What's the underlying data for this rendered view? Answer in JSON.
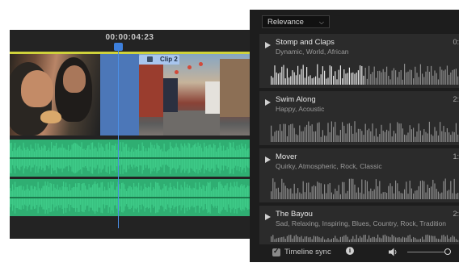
{
  "timeline": {
    "timecode": "00:00:04:23",
    "clip_label": "Clip 2",
    "accent_color": "#4c77b8",
    "audio_color": "#3ecb88"
  },
  "music_panel": {
    "sort_value": "Relevance",
    "tracks": [
      {
        "title": "Stomp and Claps",
        "tags": "Dynamic, World, African",
        "duration": "0:"
      },
      {
        "title": "Swim Along",
        "tags": "Happy, Acoustic",
        "duration": "2:"
      },
      {
        "title": "Mover",
        "tags": "Quirky, Atmospheric, Rock, Classic",
        "duration": "1:"
      },
      {
        "title": "The Bayou",
        "tags": "Sad, Relaxing, Inspiring, Blues, Country, Rock, Tradition",
        "duration": "2:"
      }
    ],
    "footer": {
      "timeline_sync_label": "Timeline sync",
      "timeline_sync_checked": true,
      "info_icon": "info-icon",
      "volume_icon": "speaker-icon",
      "volume_level": 1.0
    }
  }
}
